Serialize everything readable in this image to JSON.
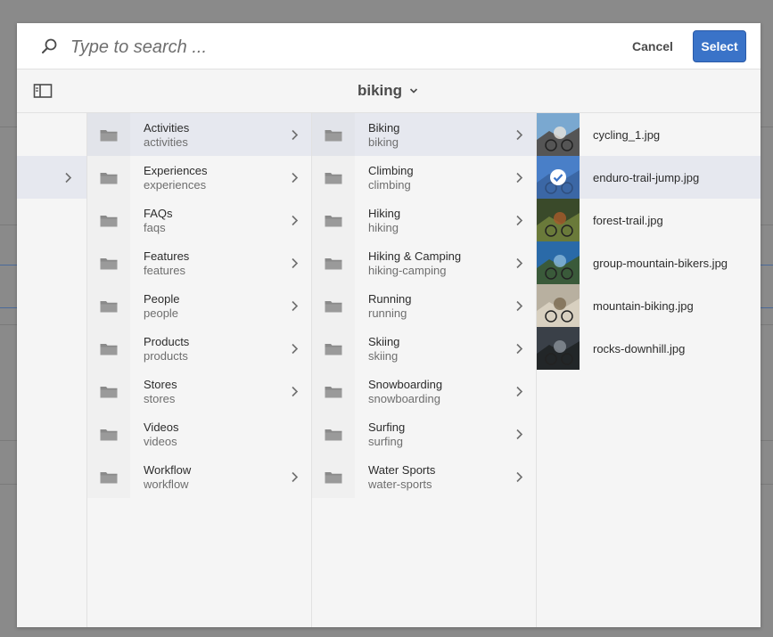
{
  "search": {
    "placeholder": "Type to search ..."
  },
  "actions": {
    "cancel_label": "Cancel",
    "select_label": "Select"
  },
  "breadcrumb": {
    "label": "biking"
  },
  "column1": {
    "items": [
      {
        "title": "Activities",
        "name": "activities",
        "has_children": true,
        "active": true
      },
      {
        "title": "Experiences",
        "name": "experiences",
        "has_children": true
      },
      {
        "title": "FAQs",
        "name": "faqs",
        "has_children": true
      },
      {
        "title": "Features",
        "name": "features",
        "has_children": true
      },
      {
        "title": "People",
        "name": "people",
        "has_children": true
      },
      {
        "title": "Products",
        "name": "products",
        "has_children": true
      },
      {
        "title": "Stores",
        "name": "stores",
        "has_children": true
      },
      {
        "title": "Videos",
        "name": "videos",
        "has_children": false
      },
      {
        "title": "Workflow",
        "name": "workflow",
        "has_children": true
      }
    ]
  },
  "column2": {
    "items": [
      {
        "title": "Biking",
        "name": "biking",
        "active": true
      },
      {
        "title": "Climbing",
        "name": "climbing"
      },
      {
        "title": "Hiking",
        "name": "hiking"
      },
      {
        "title": "Hiking & Camping",
        "name": "hiking-camping"
      },
      {
        "title": "Running",
        "name": "running"
      },
      {
        "title": "Skiing",
        "name": "skiing"
      },
      {
        "title": "Snowboarding",
        "name": "snowboarding"
      },
      {
        "title": "Surfing",
        "name": "surfing"
      },
      {
        "title": "Water Sports",
        "name": "water-sports"
      }
    ]
  },
  "assets": {
    "items": [
      {
        "filename": "cycling_1.jpg",
        "colors": [
          "#7aa8d0",
          "#e8e4dc",
          "#555555"
        ]
      },
      {
        "filename": "enduro-trail-jump.jpg",
        "selected": true,
        "colors": [
          "#5b8fc8",
          "#9bbbe0",
          "#3c5a7a"
        ]
      },
      {
        "filename": "forest-trail.jpg",
        "colors": [
          "#3a4a2a",
          "#a85a2a",
          "#6a7a3a"
        ]
      },
      {
        "filename": "group-mountain-bikers.jpg",
        "colors": [
          "#2a6aa8",
          "#8ab8d8",
          "#3a5a3a"
        ]
      },
      {
        "filename": "mountain-biking.jpg",
        "colors": [
          "#b8b0a0",
          "#7a6a50",
          "#d8d0c0"
        ]
      },
      {
        "filename": "rocks-downhill.jpg",
        "colors": [
          "#3a4048",
          "#8a9098",
          "#222628"
        ]
      }
    ]
  },
  "colors": {
    "accent": "#3a73c8",
    "active_row": "#e6e8ef"
  }
}
